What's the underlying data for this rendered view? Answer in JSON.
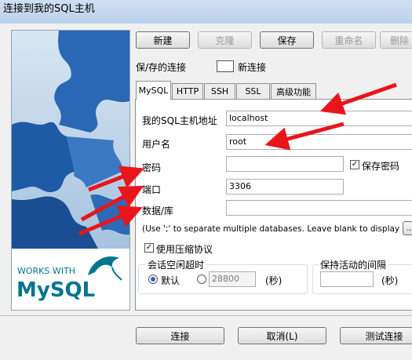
{
  "window": {
    "title": "连接到我的SQL主机"
  },
  "toolbar": {
    "new": "新建",
    "clone": "克隆",
    "save": "保存",
    "rename": "重命名",
    "delete": "删除"
  },
  "saved": {
    "label": "保/存的连接",
    "value": "新连接"
  },
  "tabs": [
    "MySQL",
    "HTTP",
    "SSH",
    "SSL",
    "高级功能"
  ],
  "form": {
    "host_label": "我的SQL主机地址",
    "host_value": "localhost",
    "user_label": "用户名",
    "user_value": "root",
    "password_label": "密码",
    "password_value": "",
    "save_password_label": "保存密码",
    "port_label": "端口",
    "port_value": "3306",
    "db_label": "数据/库",
    "db_value": "",
    "hint": "(Use ';' to separate multiple databases. Leave blank to display all)",
    "more_button": "...",
    "compress_label": "使用压缩协议",
    "timeout_group": "会话空闲超时",
    "default_label": "默认",
    "timeout_value": "28800",
    "seconds": "(秒)",
    "keepalive_group": "保持活动的间隔",
    "keepalive_seconds": "(秒)"
  },
  "logo": {
    "works_with": "WORKS WITH",
    "mysql": "MySQL"
  },
  "footer": {
    "connect": "连接",
    "cancel": "取消(L)",
    "test": "测试连接"
  },
  "colors": {
    "arrow": "#e8161b",
    "puzzle": "#1d5fb0",
    "mysql_blue": "#00758f",
    "mysql_orange": "#f29111"
  }
}
